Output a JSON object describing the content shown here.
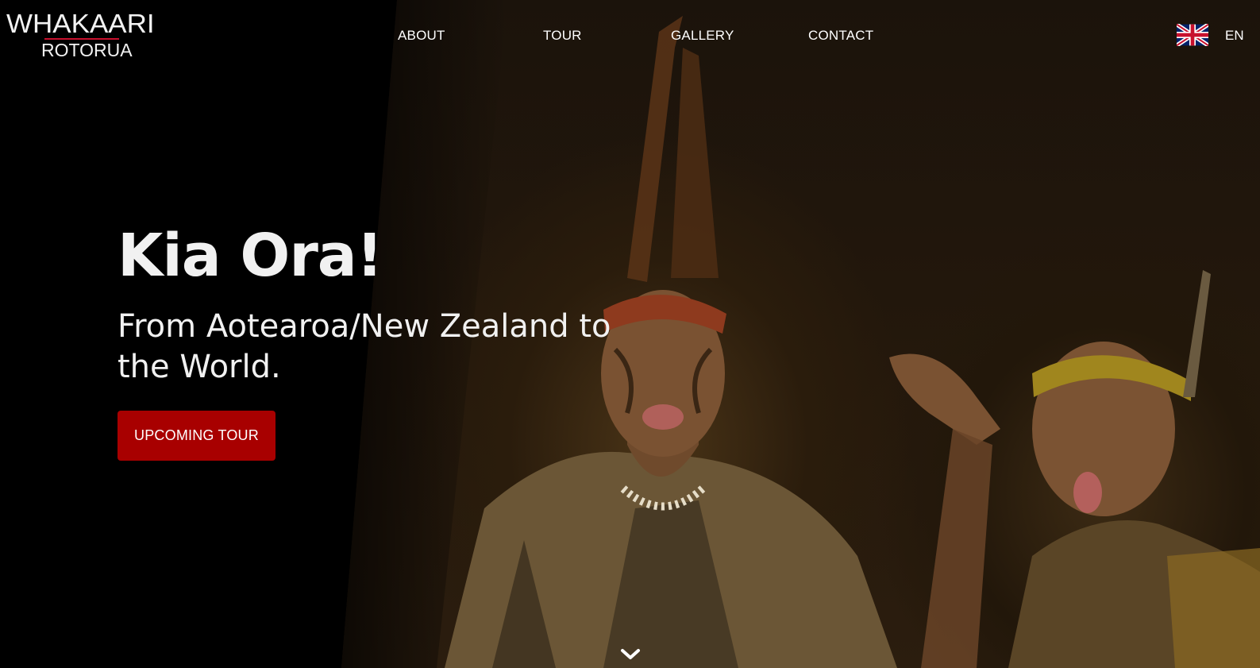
{
  "brand": {
    "logo_top": "WHAKAARI",
    "logo_bottom": "ROTORUA",
    "accent_color": "#c8102e"
  },
  "nav": {
    "items": [
      {
        "label": "ABOUT"
      },
      {
        "label": "TOUR"
      },
      {
        "label": "GALLERY"
      },
      {
        "label": "CONTACT"
      }
    ]
  },
  "language": {
    "flag_icon": "uk-flag-icon",
    "label": "EN"
  },
  "hero": {
    "headline": "Kia Ora!",
    "subline": "From Aotearoa/New Zealand to the World.",
    "cta_label": "UPCOMING TOUR",
    "cta_color": "#a80000",
    "scroll_icon": "chevron-down-icon"
  }
}
